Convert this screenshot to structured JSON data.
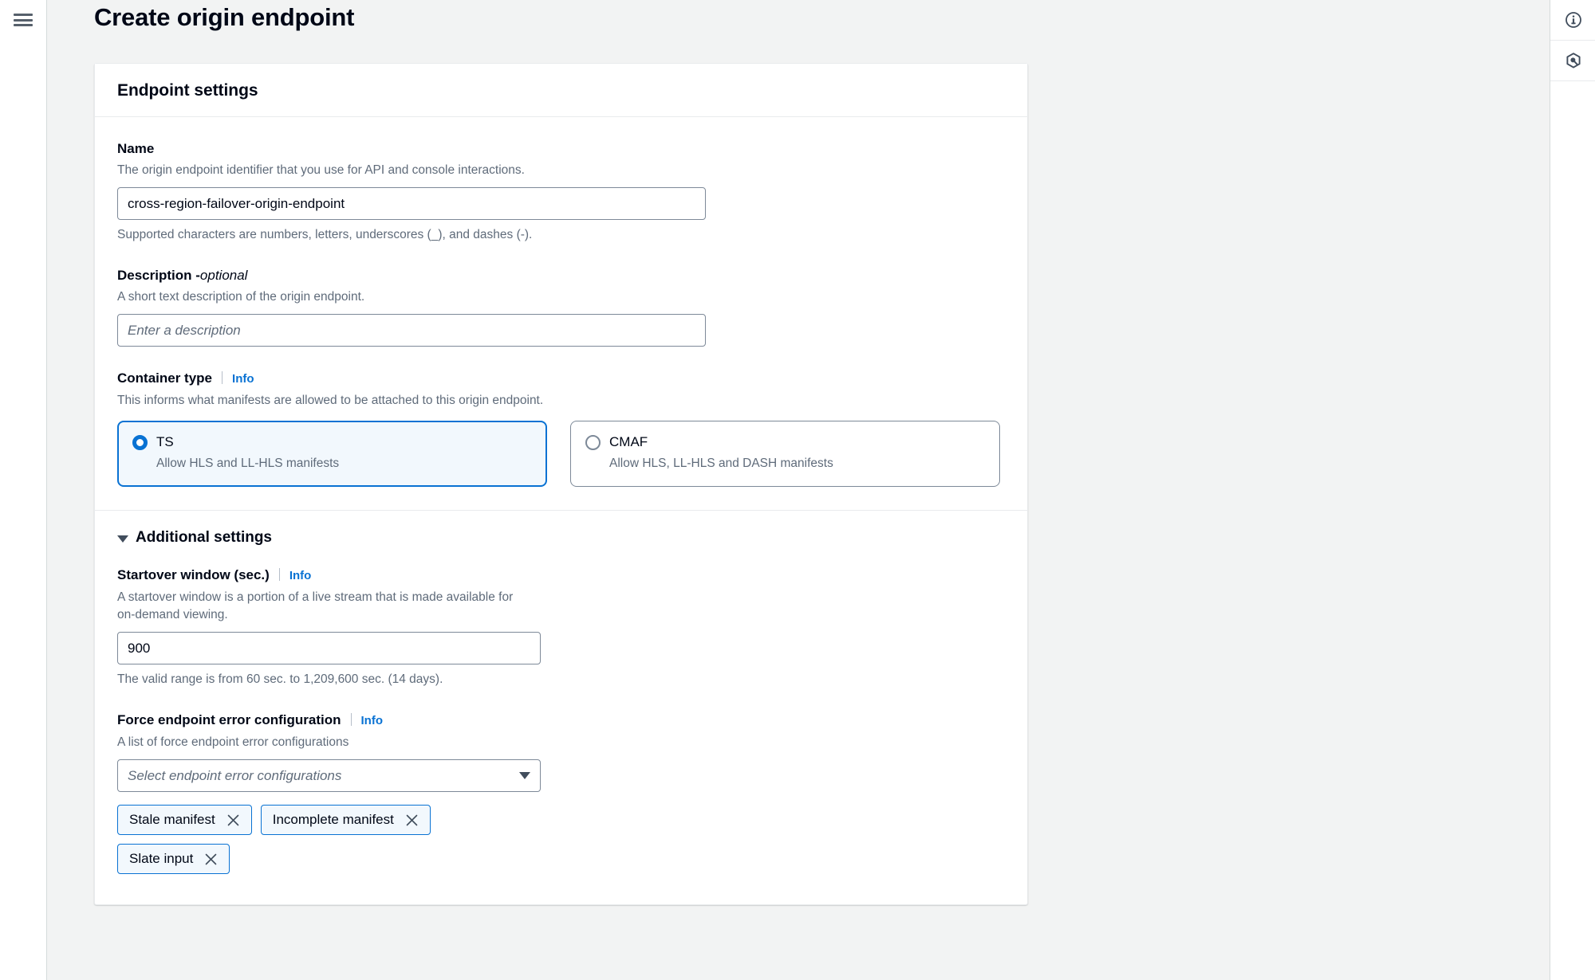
{
  "page": {
    "title": "Create origin endpoint"
  },
  "left_rail": {
    "menu_icon": "hamburger-menu-icon"
  },
  "right_rail": {
    "items": [
      {
        "icon": "info-circle-icon",
        "name": "help-panel-toggle"
      },
      {
        "icon": "shield-hex-icon",
        "name": "assistant-toggle"
      }
    ]
  },
  "card": {
    "header": "Endpoint settings",
    "name_field": {
      "label": "Name",
      "description": "The origin endpoint identifier that you use for API and console interactions.",
      "value": "cross-region-failover-origin-endpoint",
      "hint": "Supported characters are numbers, letters, underscores (_), and dashes (-)."
    },
    "description_field": {
      "label": "Description - ",
      "label_optional": "optional",
      "description": "A short text description of the origin endpoint.",
      "value": "",
      "placeholder": "Enter a description"
    },
    "container_type": {
      "label": "Container type",
      "info_label": "Info",
      "description": "This informs what manifests are allowed to be attached to this origin endpoint.",
      "options": [
        {
          "title": "TS",
          "description": "Allow HLS and LL-HLS manifests",
          "selected": true
        },
        {
          "title": "CMAF",
          "description": "Allow HLS, LL-HLS and DASH manifests",
          "selected": false
        }
      ]
    },
    "additional_settings": {
      "title": "Additional settings",
      "expanded": true,
      "startover": {
        "label": "Startover window (sec.)",
        "info_label": "Info",
        "description": "A startover window is a portion of a live stream that is made available for on-demand viewing.",
        "value": "900",
        "hint": "The valid range is from 60 sec. to 1,209,600 sec. (14 days)."
      },
      "force_error": {
        "label": "Force endpoint error configuration",
        "info_label": "Info",
        "description": "A list of force endpoint error configurations",
        "select_placeholder": "Select endpoint error configurations",
        "selected_chips": [
          "Stale manifest",
          "Incomplete manifest",
          "Slate input"
        ]
      }
    }
  },
  "colors": {
    "accent": "#0972d3",
    "selected_tile_bg": "#f2f8fd",
    "page_bg": "#f2f3f3",
    "text": "#000716",
    "muted_text": "#5f6b7a",
    "border": "#7d8998"
  }
}
